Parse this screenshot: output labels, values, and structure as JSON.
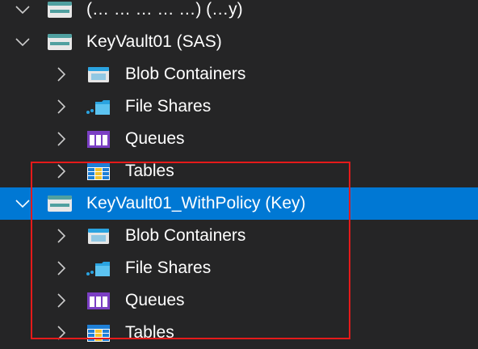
{
  "tree": {
    "partial_top_label": "(… … … … …) (…y)",
    "accounts": [
      {
        "name": "KeyVault01 (SAS)",
        "expanded": true,
        "selected": false,
        "children": [
          "Blob Containers",
          "File Shares",
          "Queues",
          "Tables"
        ]
      },
      {
        "name": "KeyVault01_WithPolicy (Key)",
        "expanded": true,
        "selected": true,
        "children": [
          "Blob Containers",
          "File Shares",
          "Queues",
          "Tables"
        ]
      }
    ]
  },
  "icons": {
    "account": "storage-account-icon",
    "blob": "blob-containers-icon",
    "file": "file-shares-icon",
    "queue": "queues-icon",
    "table": "tables-icon"
  },
  "colors": {
    "background": "#252526",
    "selection": "#0078d4",
    "highlight_border": "#e51a1a",
    "text": "#ffffff"
  }
}
